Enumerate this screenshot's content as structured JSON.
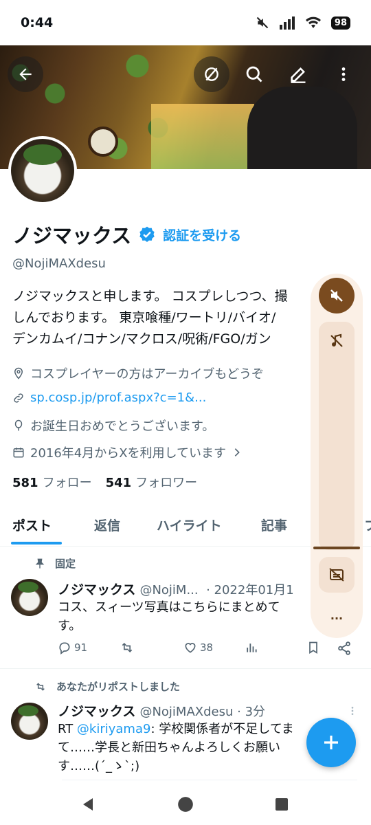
{
  "status": {
    "time": "0:44",
    "battery": "98"
  },
  "profile": {
    "name": "ノジマックス",
    "verify_label": "認証を受ける",
    "handle": "@NojiMAXdesu",
    "bio_lines": [
      "ノジマックスと申します。 コスプレしつつ、撮",
      "しんでおります。 東京喰種/ワートリ/バイオ/",
      "デンカムイ/コナン/マクロス/呪術/FGO/ガン"
    ],
    "category": "コスプレイヤーの方はアーカイブもどうぞ",
    "link": "sp.cosp.jp/prof.aspx?c=1&...",
    "birthday": "お誕生日おめでとうございます。",
    "joined": "2016年4月からXを利用しています",
    "following_count": "581",
    "following_label": "フォロー",
    "followers_count": "541",
    "followers_label": "フォロワー"
  },
  "tabs": [
    {
      "label": "ポスト"
    },
    {
      "label": "返信"
    },
    {
      "label": "ハイライト"
    },
    {
      "label": "記事"
    },
    {
      "label": "フ"
    }
  ],
  "tweets": [
    {
      "label": "固定",
      "name": "ノジマックス",
      "handle": "@NojiM...",
      "date": "· 2022年01月1",
      "text": "コス、スィーツ写真はこちらにまとめて",
      "text2": "す。",
      "replies": "91",
      "likes": "38"
    },
    {
      "label": "あなたがリポストしました",
      "name": "ノジマックス",
      "handle": "@NojiMAXdesu",
      "date": "· 3分",
      "rt_prefix": "RT ",
      "mention": "@kiriyama9",
      "text": ": 学校関係者が不足してま",
      "text2": "て……学長と新田ちゃんよろしくお願い",
      "text3": "す……(´_ゝ`;)"
    }
  ],
  "volume_panel": {
    "more_label": "..."
  },
  "colors": {
    "accent": "#1d9bf0",
    "panel": "#fbf0e6",
    "panel_dark": "#7a4b1f"
  }
}
